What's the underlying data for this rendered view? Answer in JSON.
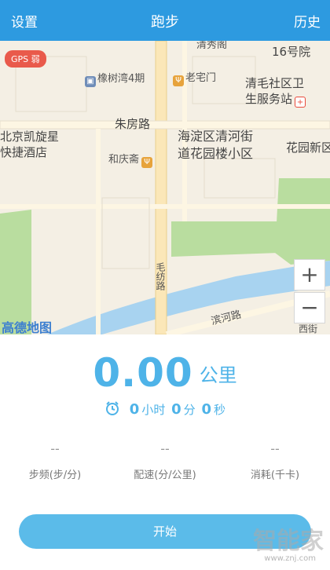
{
  "header": {
    "settings_label": "设置",
    "title": "跑步",
    "history_label": "历史"
  },
  "map": {
    "gps_badge": "GPS 弱",
    "labels": {
      "xiushuying": "清秀阁",
      "hao16": "16号院",
      "xiangshuwan": "橡树湾4期",
      "laozhaimen": "老宅门",
      "qingmao": "清毛社区卫",
      "qingmao2": "生服务站",
      "zhufanglu": "朱房路",
      "hotel1": "北京凯旋星",
      "hotel2": "快捷酒店",
      "haidian1": "海淀区清河街",
      "haidian2": "道花园楼小区",
      "huayuan": "花园新区",
      "heqingzhai": "和庆斋",
      "maofanglu": "毛纺路",
      "binhelu": "滨河路",
      "xijie": "西街",
      "amap_logo": "高德地图"
    },
    "zoom_in": "+",
    "zoom_out": "−"
  },
  "stats": {
    "distance_value": "0.00",
    "distance_unit": "公里",
    "hours": "0",
    "hours_unit": "小时",
    "minutes": "0",
    "minutes_unit": "分",
    "seconds": "0",
    "seconds_unit": "秒",
    "metrics": [
      {
        "value": "--",
        "label": "步频(步/分)"
      },
      {
        "value": "--",
        "label": "配速(分/公里)"
      },
      {
        "value": "--",
        "label": "消耗(千卡)"
      }
    ],
    "start_label": "开始"
  },
  "watermark": {
    "text": "智能家",
    "url": "www.znj.com"
  },
  "colors": {
    "header_bg": "#2d9ae0",
    "accent": "#4eb3e8",
    "button": "#5bbbe9",
    "gps_badge": "#e95a4b"
  }
}
